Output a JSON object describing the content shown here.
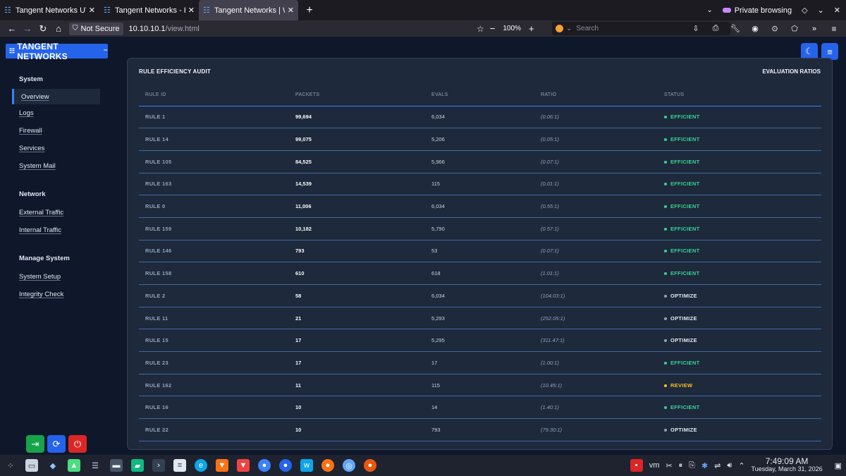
{
  "browser": {
    "tabs": [
      {
        "title": "Tangent Networks UTM —",
        "active": false
      },
      {
        "title": "Tangent Networks - Home",
        "active": false
      },
      {
        "title": "Tangent Networks | Web i",
        "active": true
      }
    ],
    "private_label": "Private browsing",
    "security_label": "Not Secure",
    "url_host": "10.10.10.1",
    "url_path": "/view.html",
    "zoom": "100%",
    "search_placeholder": "Search"
  },
  "app": {
    "brand": "TANGENT NETWORKS",
    "brand_mark": "™",
    "sidebar": [
      {
        "heading": "System",
        "items": [
          {
            "label": "Overview",
            "active": true
          },
          {
            "label": "Logs"
          },
          {
            "label": "Firewall"
          },
          {
            "label": "Services"
          },
          {
            "label": "System Mail"
          }
        ]
      },
      {
        "heading": "Network",
        "items": [
          {
            "label": "External Traffic"
          },
          {
            "label": "Internal Traffic"
          }
        ]
      },
      {
        "heading": "Manage System",
        "items": [
          {
            "label": "System Setup"
          },
          {
            "label": "Integrity Check"
          }
        ]
      }
    ],
    "panel": {
      "title": "RULE EFFICIENCY AUDIT",
      "subtitle": "EVALUATION RATIOS",
      "columns": [
        "RULE ID",
        "PACKETS",
        "EVALS",
        "RATIO",
        "STATUS"
      ],
      "status_colors": {
        "EFFICIENT": "#34d399",
        "OPTIMIZE": "#94a3b8",
        "REVIEW": "#fbbf24"
      },
      "rows": [
        {
          "id": "RULE 1",
          "packets": "99,694",
          "evals": "6,034",
          "ratio": "(0.06:1)",
          "status": "EFFICIENT"
        },
        {
          "id": "RULE 14",
          "packets": "99,075",
          "evals": "5,206",
          "ratio": "(0.05:1)",
          "status": "EFFICIENT"
        },
        {
          "id": "RULE 105",
          "packets": "84,525",
          "evals": "5,966",
          "ratio": "(0.07:1)",
          "status": "EFFICIENT"
        },
        {
          "id": "RULE 163",
          "packets": "14,539",
          "evals": "115",
          "ratio": "(0.01:1)",
          "status": "EFFICIENT"
        },
        {
          "id": "RULE 0",
          "packets": "11,006",
          "evals": "6,034",
          "ratio": "(0.55:1)",
          "status": "EFFICIENT"
        },
        {
          "id": "RULE 159",
          "packets": "10,182",
          "evals": "5,790",
          "ratio": "(0.57:1)",
          "status": "EFFICIENT"
        },
        {
          "id": "RULE 146",
          "packets": "793",
          "evals": "53",
          "ratio": "(0.07:1)",
          "status": "EFFICIENT"
        },
        {
          "id": "RULE 158",
          "packets": "610",
          "evals": "618",
          "ratio": "(1.01:1)",
          "status": "EFFICIENT"
        },
        {
          "id": "RULE 2",
          "packets": "58",
          "evals": "6,034",
          "ratio": "(104.03:1)",
          "status": "OPTIMIZE"
        },
        {
          "id": "RULE 11",
          "packets": "21",
          "evals": "5,293",
          "ratio": "(252.05:1)",
          "status": "OPTIMIZE"
        },
        {
          "id": "RULE 15",
          "packets": "17",
          "evals": "5,295",
          "ratio": "(311.47:1)",
          "status": "OPTIMIZE"
        },
        {
          "id": "RULE 23",
          "packets": "17",
          "evals": "17",
          "ratio": "(1.00:1)",
          "status": "EFFICIENT"
        },
        {
          "id": "RULE 162",
          "packets": "11",
          "evals": "115",
          "ratio": "(10.45:1)",
          "status": "REVIEW"
        },
        {
          "id": "RULE 16",
          "packets": "10",
          "evals": "14",
          "ratio": "(1.40:1)",
          "status": "EFFICIENT"
        },
        {
          "id": "RULE 22",
          "packets": "10",
          "evals": "793",
          "ratio": "(79.30:1)",
          "status": "OPTIMIZE"
        }
      ]
    }
  },
  "taskbar": {
    "time": "7:49:09 AM",
    "date": "Tuesday, March 31, 2026"
  }
}
